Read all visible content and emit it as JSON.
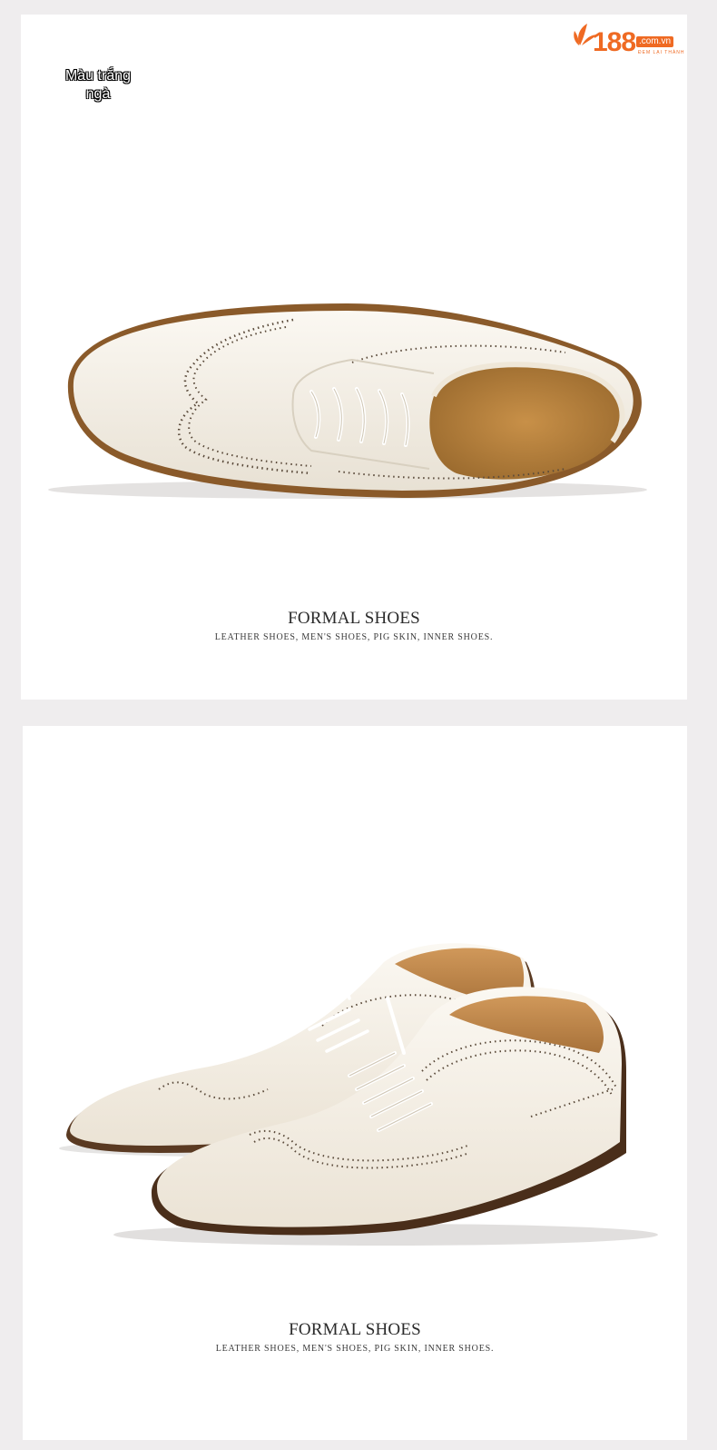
{
  "brand": {
    "logo_number": "188",
    "logo_domain": ".com.vn",
    "logo_tagline": "ĐEM LẠI THÀNH",
    "accent_color": "#ef6a23"
  },
  "color_tag": {
    "label": "Màu trắng ngà",
    "bar_color": "#b01818"
  },
  "panels": [
    {
      "title": "FORMAL SHOES",
      "subtitle": "LEATHER SHOES, MEN'S SHOES, PIG SKIN, INNER SHOES."
    },
    {
      "title": "FORMAL SHOES",
      "subtitle": "LEATHER SHOES, MEN'S SHOES, PIG SKIN, INNER SHOES."
    }
  ],
  "product_color": "#f3ede2"
}
